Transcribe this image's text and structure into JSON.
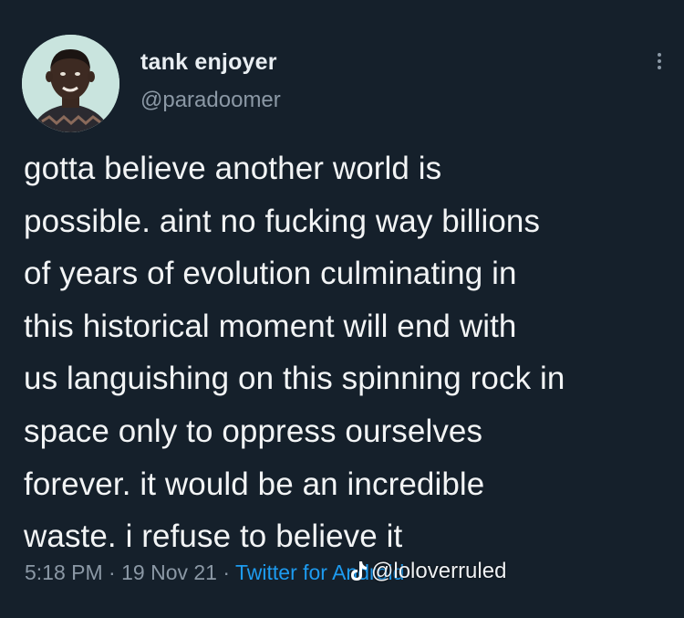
{
  "author": {
    "display_name": "tank enjoyer",
    "handle": "@paradoomer"
  },
  "tweet": {
    "text": "gotta believe another world is\npossible. aint no fucking way billions\nof years of evolution culminating in\nthis historical moment will end with\nus languishing on this spinning rock in\nspace only to oppress ourselves\nforever. it would be an incredible\nwaste. i refuse to believe it",
    "time": "5:18 PM",
    "date": "19 Nov 21",
    "source": "Twitter for Android"
  },
  "watermark": {
    "icon": "tiktok-icon",
    "handle": "@loloverruled"
  },
  "colors": {
    "background": "#15202b",
    "text": "#f2f4f5",
    "muted": "#8b98a5",
    "link": "#1d9bf0"
  }
}
